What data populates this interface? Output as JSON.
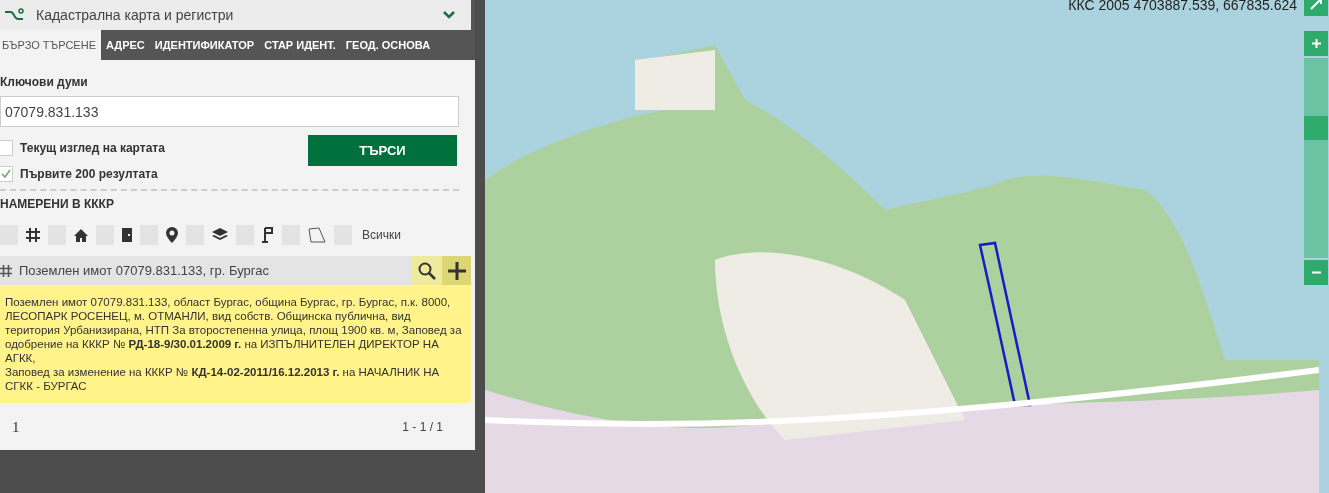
{
  "header": {
    "title": "Кадастрална карта и регистри",
    "expanded": true
  },
  "tabs": [
    {
      "label": "БЪРЗО ТЪРСЕНЕ",
      "selected": true
    },
    {
      "label": "АДРЕС",
      "selected": false
    },
    {
      "label": "ИДЕНТИФИКАТОР",
      "selected": false
    },
    {
      "label": "СТАР ИДЕНТ.",
      "selected": false
    },
    {
      "label": "ГЕОД. ОСНОВА",
      "selected": false
    }
  ],
  "keywords": {
    "label": "Ключови думи",
    "value": "07079.831.133"
  },
  "options": [
    {
      "label": "Текущ изглед на картата",
      "checked": false
    },
    {
      "label": "Първите 200 резултата",
      "checked": true
    }
  ],
  "search_button": "ТЪРСИ",
  "results": {
    "title": "НАМЕРЕНИ В КККР",
    "filters": [
      {
        "checked": false
      },
      {
        "checked": false
      },
      {
        "checked": false
      },
      {
        "checked": false
      },
      {
        "checked": false
      },
      {
        "checked": false
      },
      {
        "checked": false
      },
      {
        "checked": false,
        "label": "Всички"
      }
    ],
    "items": [
      {
        "title": "Поземлен имот 07079.831.133, гр. Бургас",
        "details": "Поземлен имот 07079.831.133, област Бургас, община Бургас, гр. Бургас, п.к. 8000, ЛЕСОПАРК РОСЕНЕЦ, м. ОТМАНЛИ, вид собств. Общинска публична, вид територия Урбанизирана, НТП За второстепенна улица, площ 1900 кв. м, Заповед за одобрение на КККР № **РД-18-9/30.01.2009 г.** на ИЗПЪЛНИТЕЛЕН ДИРЕКТОР НА АГКК,\nЗаповед за изменение на КККР № **КД-14-02-2011/16.12.2013 г.** на НАЧАЛНИК НА СГКК - БУРГАС"
      }
    ],
    "page": "1",
    "range": "1 - 1 / 1"
  },
  "map": {
    "coordinates": "ККС 2005 4703887.539, 667835.624",
    "zoom": {
      "level": 0.67
    }
  }
}
